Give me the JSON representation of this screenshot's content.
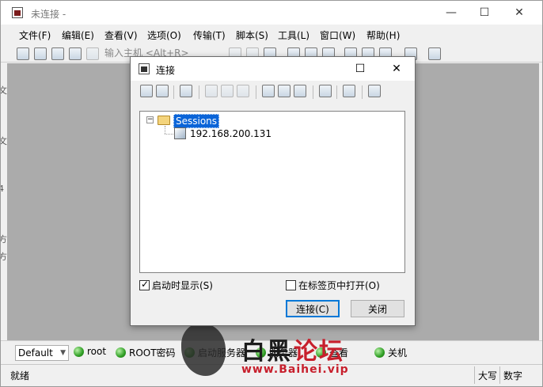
{
  "window": {
    "title": "未连接 -",
    "minimize": "—",
    "maximize": "☐",
    "close": "✕"
  },
  "menu": [
    "文件(F)",
    "编辑(E)",
    "查看(V)",
    "选项(O)",
    "传输(T)",
    "脚本(S)",
    "工具(L)",
    "窗口(W)",
    "帮助(H)"
  ],
  "toolbar": {
    "quick_connect_placeholder": "输入主机 <Alt+R>"
  },
  "left_fragments": [
    "文",
    "文",
    "4",
    "方",
    "方"
  ],
  "dialog": {
    "title": "连接",
    "maximize": "☐",
    "close": "✕",
    "tree": {
      "root": "Sessions",
      "expander": "−",
      "host": "192.168.200.131"
    },
    "show_on_startup": "启动时显示(S)",
    "open_in_tab": "在标签页中打开(O)",
    "connect_button": "连接(C)",
    "close_button": "关闭"
  },
  "button_bar": {
    "session": "Default",
    "commands": [
      "root",
      "ROOT密码",
      "启动服务器",
      "服务器",
      "查看",
      "关机"
    ]
  },
  "status_bar": {
    "ready": "就绪",
    "caps": "大写",
    "num": "数字"
  },
  "watermark": {
    "text1": "白黑",
    "text2": "论坛",
    "url": "www.Baihei.vip"
  },
  "colors": {
    "selection": "#0a64d8",
    "default_button_border": "#0078d7",
    "status_green": "#2f9e24",
    "watermark_red": "#c71f2c"
  }
}
